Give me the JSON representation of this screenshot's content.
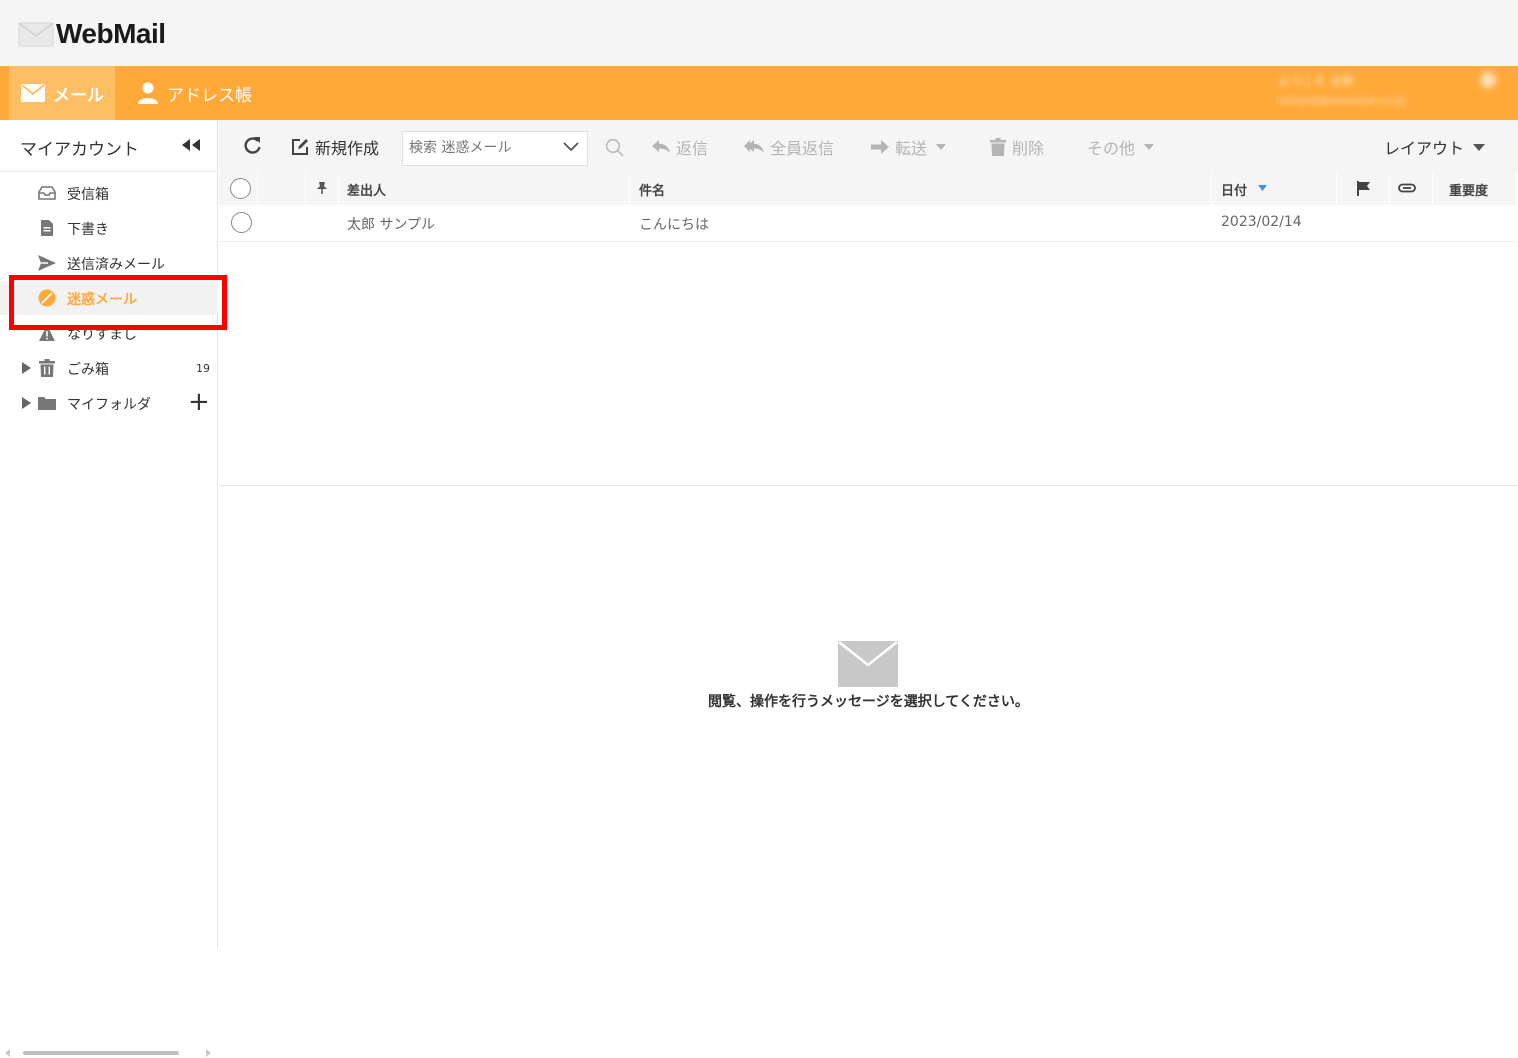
{
  "app": {
    "logo_text": "WebMail"
  },
  "nav": {
    "mail_label": "メール",
    "address_label": "アドレス帳",
    "user_line1": "ようこそ 太郎",
    "user_line2": "sample@example.co.jp"
  },
  "sidebar": {
    "title": "マイアカウント",
    "folders": [
      {
        "label": "受信箱",
        "icon": "inbox-icon"
      },
      {
        "label": "下書き",
        "icon": "draft-icon"
      },
      {
        "label": "送信済みメール",
        "icon": "sent-icon"
      },
      {
        "label": "迷惑メール",
        "icon": "spam-icon",
        "active": true
      },
      {
        "label": "なりすまし",
        "icon": "warning-icon"
      },
      {
        "label": "ごみ箱",
        "icon": "trash-icon",
        "count": "19"
      },
      {
        "label": "マイフォルダ",
        "icon": "folder-icon"
      }
    ]
  },
  "toolbar": {
    "new_label": "新規作成",
    "search_placeholder": "検索 迷惑メール",
    "reply_label": "返信",
    "reply_all_label": "全員返信",
    "forward_label": "転送",
    "delete_label": "削除",
    "other_label": "その他",
    "layout_label": "レイアウト"
  },
  "list": {
    "columns": {
      "sender": "差出人",
      "subject": "件名",
      "date": "日付",
      "importance": "重要度"
    },
    "rows": [
      {
        "sender": "太郎 サンプル",
        "subject": "こんにちは",
        "date": "2023/02/14"
      }
    ]
  },
  "preview": {
    "empty_message": "閲覧、操作を行うメッセージを選択してください。"
  },
  "colors": {
    "accent": "#ffa939",
    "highlight_box": "#ff0000"
  }
}
